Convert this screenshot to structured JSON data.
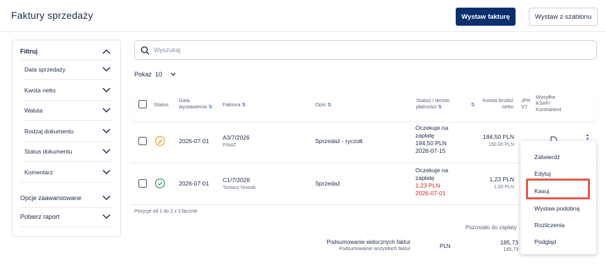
{
  "header": {
    "title": "Faktury sprzedaży",
    "primary_button": "Wystaw fakturę",
    "secondary_button": "Wystaw z szablonu"
  },
  "sidebar": {
    "filter_label": "Filtruj",
    "items": [
      "Data sprzedaży",
      "Kwota netto",
      "Waluta",
      "Rodzaj dokumentu",
      "Status dokumentu",
      "Komentarz"
    ],
    "advanced_label": "Opcje zaawansowane",
    "report_label": "Pobierz raport"
  },
  "search": {
    "placeholder": "Wyszukaj"
  },
  "pagination": {
    "show_label": "Pokaż",
    "page_size": "10"
  },
  "table": {
    "headers": {
      "status": "Status",
      "date_l1": "Data",
      "date_l2": "wystawienia",
      "invoice": "Faktura",
      "description": "Opis",
      "status_due_l1": "Status / termin",
      "status_due_l2": "płatności",
      "gross_l1": "Kwota brutto/",
      "gross_l2": "netto",
      "jpk_l1": "JPK",
      "jpk_l2": "V7",
      "ksef_l1": "Wysyłka",
      "ksef_l2": "KSeF/",
      "ksef_l3": "Kontrahent"
    },
    "rows": [
      {
        "date": "2026-07-01",
        "invoice": "A3/7/2026",
        "contractor": "FINAT",
        "description": "Sprzedaż - ryczołt",
        "status_l1": "Oczekuje na",
        "status_l2": "zapłatę",
        "status_amount": "184,50 PLN",
        "status_date": "2026-07-15",
        "gross": "184,50 PLN",
        "net": "150,00 PLN"
      },
      {
        "date": "2026-07-01",
        "invoice": "C1/7/2026",
        "contractor": "Tomasz Nowak",
        "description": "Sprzedaż",
        "status_l1": "Oczekuje na",
        "status_l2": "zapłatę",
        "status_amount": "1,23 PLN",
        "status_date": "2026-07-01",
        "gross": "1,23 PLN",
        "net": "1,00 PLN"
      }
    ],
    "positions_text": "Pozycje od 1 do 2 z 2 łącznie"
  },
  "summary": {
    "remaining_label": "Pozostało do zapłaty",
    "visible_label": "Podsumowanie widocznych faktur",
    "all_label": "Podsumowanie wszystkich faktur",
    "currency": "PLN",
    "visible_value": "185,73",
    "all_value": "185,73"
  },
  "context_menu": {
    "items": [
      "Zatwierdź",
      "Edytuj",
      "Kasuj",
      "Wystaw podobną",
      "Rozliczenia",
      "Podgląd"
    ],
    "highlighted": "Kasuj"
  },
  "colors": {
    "primary": "#0b2f6e",
    "pending_icon": "#f0a030",
    "paid_icon": "#2e9b57",
    "overdue": "#d8232a",
    "highlight": "#e05a4d"
  }
}
